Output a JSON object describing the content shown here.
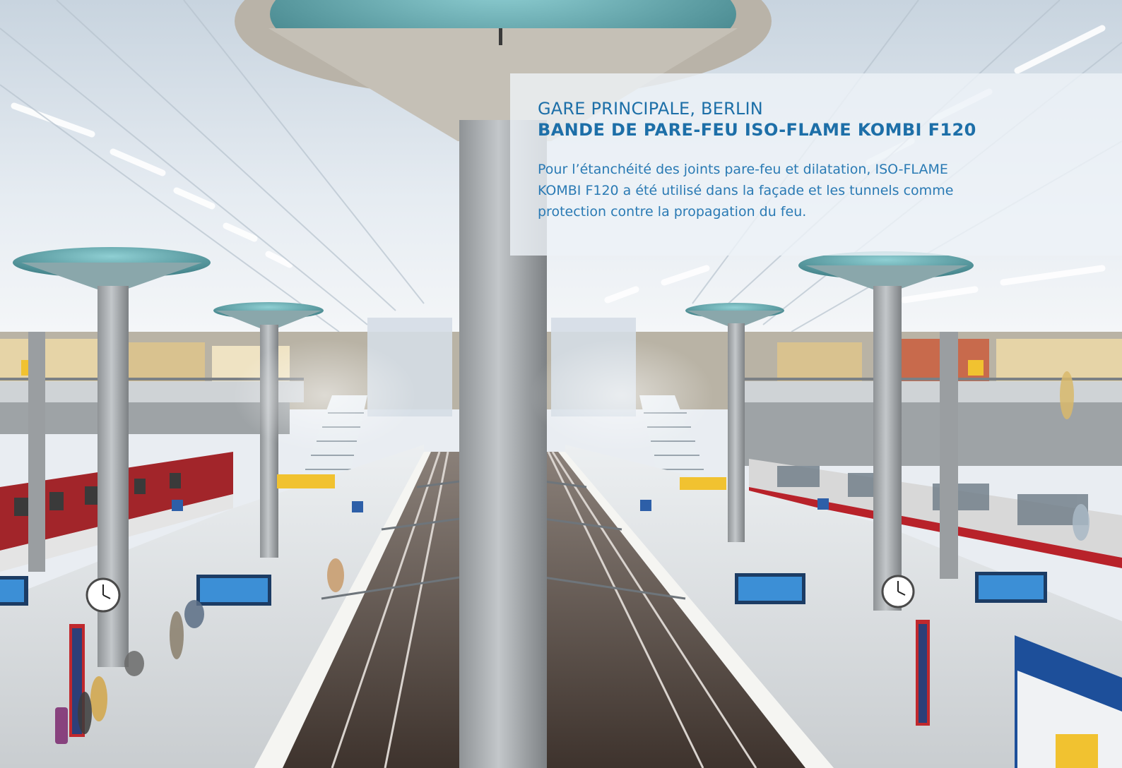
{
  "caption": {
    "location": "GARE PRINCIPALE, BERLIN",
    "product": "BANDE DE PARE-FEU ISO-FLAME KOMBI F120",
    "description": "Pour l’étanchéité des joints pare-feu et dilatation, ISO-FLAME KOMBI F120 a été utilisé dans la façade et les tunnels comme protection contre la propagation du feu."
  },
  "photo": {
    "subject": "railway-station-platform-photo",
    "colors": {
      "ceiling": "#dfe6ee",
      "column": "#a9adb0",
      "platform": "#d7dadc",
      "track": "#4a3f38",
      "accent_yellow": "#f1c230",
      "accent_red": "#c0282d",
      "display_blue": "#3c8fd6",
      "caption_text": "#1d6fa8"
    }
  }
}
